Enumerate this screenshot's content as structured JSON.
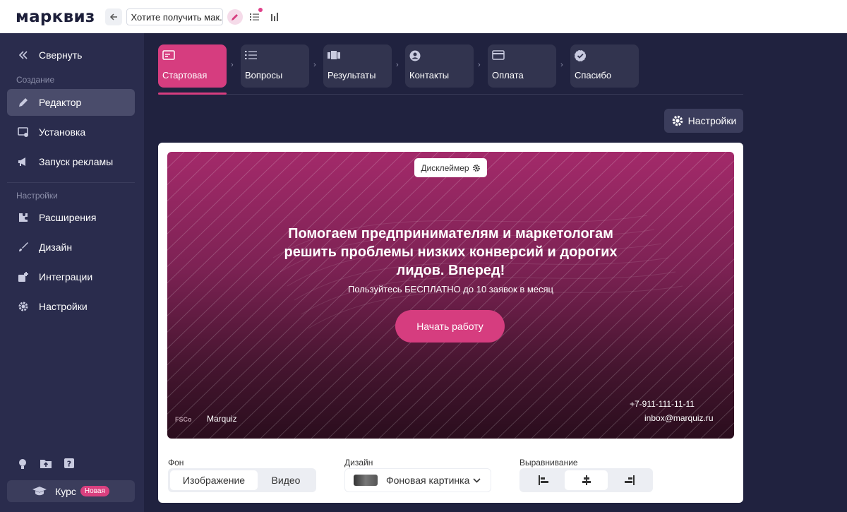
{
  "topbar": {
    "logo": "марквиз",
    "quiz_name": "Хотите получить мак..."
  },
  "sidebar": {
    "collapse_label": "Свернуть",
    "section_create": "Создание",
    "items_create": [
      {
        "label": "Редактор",
        "icon": "pencil-icon",
        "active": true
      },
      {
        "label": "Установка",
        "icon": "install-icon"
      },
      {
        "label": "Запуск рекламы",
        "icon": "megaphone-icon"
      }
    ],
    "section_settings": "Настройки",
    "items_settings": [
      {
        "label": "Расширения",
        "icon": "puzzle-icon"
      },
      {
        "label": "Дизайн",
        "icon": "brush-icon"
      },
      {
        "label": "Интеграции",
        "icon": "integration-icon"
      },
      {
        "label": "Настройки",
        "icon": "gear-icon"
      }
    ],
    "course_label": "Курс",
    "course_badge": "Новая"
  },
  "steps": [
    {
      "label": "Стартовая",
      "icon": "start-page-icon",
      "active": true
    },
    {
      "label": "Вопросы",
      "icon": "list-icon"
    },
    {
      "label": "Результаты",
      "icon": "results-icon"
    },
    {
      "label": "Контакты",
      "icon": "contact-icon"
    },
    {
      "label": "Оплата",
      "icon": "card-icon"
    },
    {
      "label": "Спасибо",
      "icon": "check-badge-icon"
    }
  ],
  "settings_button": "Настройки",
  "hero": {
    "disclaimer": "Дисклеймер",
    "title": "Помогаем предпринимателям и маркетологам решить проблемы низких конверсий и дорогих лидов. Вперед!",
    "subtitle": "Пользуйтесь БЕСПЛАТНО до 10 заявок в месяц",
    "cta": "Начать работу",
    "logo_mark": "FSCo",
    "brand": "Marquiz",
    "phone": "+7-911-111-11-11",
    "email": "inbox@marquiz.ru"
  },
  "controls": {
    "bg_label": "Фон",
    "bg_options": [
      "Изображение",
      "Видео"
    ],
    "bg_selected": "Изображение",
    "design_label": "Дизайн",
    "design_value": "Фоновая картинка",
    "align_label": "Выравнивание",
    "align_options": [
      "align-left-icon",
      "align-center-icon",
      "align-right-icon"
    ],
    "align_selected": "align-center-icon"
  },
  "colors": {
    "accent": "#d63d7f",
    "sidebar_bg": "#2a2c4d",
    "page_bg": "#20223f"
  }
}
